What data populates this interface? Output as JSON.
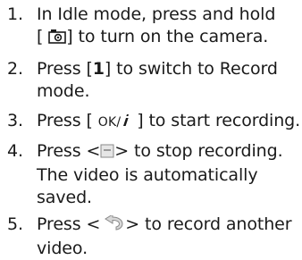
{
  "steps": [
    {
      "number": "1.",
      "lines": [
        "In Idle mode, press and hold",
        "to turn on the camera."
      ],
      "key_camera_icon": "camera-key-icon"
    },
    {
      "number": "2.",
      "line1_pre": "Press [",
      "key": "1",
      "line1_post": "] to switch to Record",
      "line2": "mode."
    },
    {
      "number": "3.",
      "pre": "Press [",
      "key_text": "OK/",
      "key_icon": "internet-i-icon",
      "post": "] to start recording."
    },
    {
      "number": "4.",
      "pre": "Press <",
      "key_icon": "softkey-square-icon",
      "post": "> to stop recording.",
      "lines": [
        "The video is automatically",
        "saved."
      ]
    },
    {
      "number": "5.",
      "pre": "Press <",
      "key_icon": "back-arrow-icon",
      "post": "> to record another",
      "line2": "video."
    }
  ]
}
